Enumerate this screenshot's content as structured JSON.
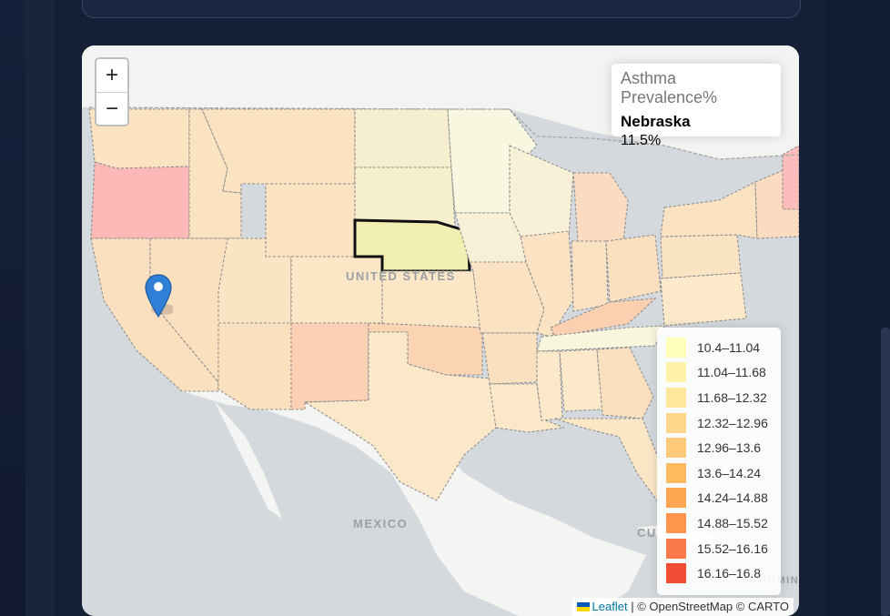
{
  "zoom": {
    "in_label": "+",
    "out_label": "−"
  },
  "info_panel": {
    "title": "Asthma Prevalence%",
    "state": "Nebraska",
    "value": "11.5%"
  },
  "legend": [
    {
      "label": "10.4–11.04",
      "color": "#ffffb2"
    },
    {
      "label": "11.04–11.68",
      "color": "#fff2a1"
    },
    {
      "label": "11.68–12.32",
      "color": "#fee391"
    },
    {
      "label": "12.32–12.96",
      "color": "#fed37f"
    },
    {
      "label": "12.96–13.6",
      "color": "#fec46c"
    },
    {
      "label": "13.6–14.24",
      "color": "#feb24c"
    },
    {
      "label": "14.24–14.88",
      "color": "#fd9c3f"
    },
    {
      "label": "14.88–15.52",
      "color": "#fd8a3a"
    },
    {
      "label": "15.52–16.16",
      "color": "#fc6a38"
    },
    {
      "label": "16.16–16.8",
      "color": "#f03b20"
    }
  ],
  "map_labels": {
    "usa": "UNITED STATES",
    "mexico": "MEXICO",
    "cuba": "CU",
    "dominican": "DOMIN"
  },
  "attribution": {
    "leaflet": "Leaflet",
    "rest": "| © OpenStreetMap © CARTO"
  },
  "marker_icon": "map-pin-icon"
}
